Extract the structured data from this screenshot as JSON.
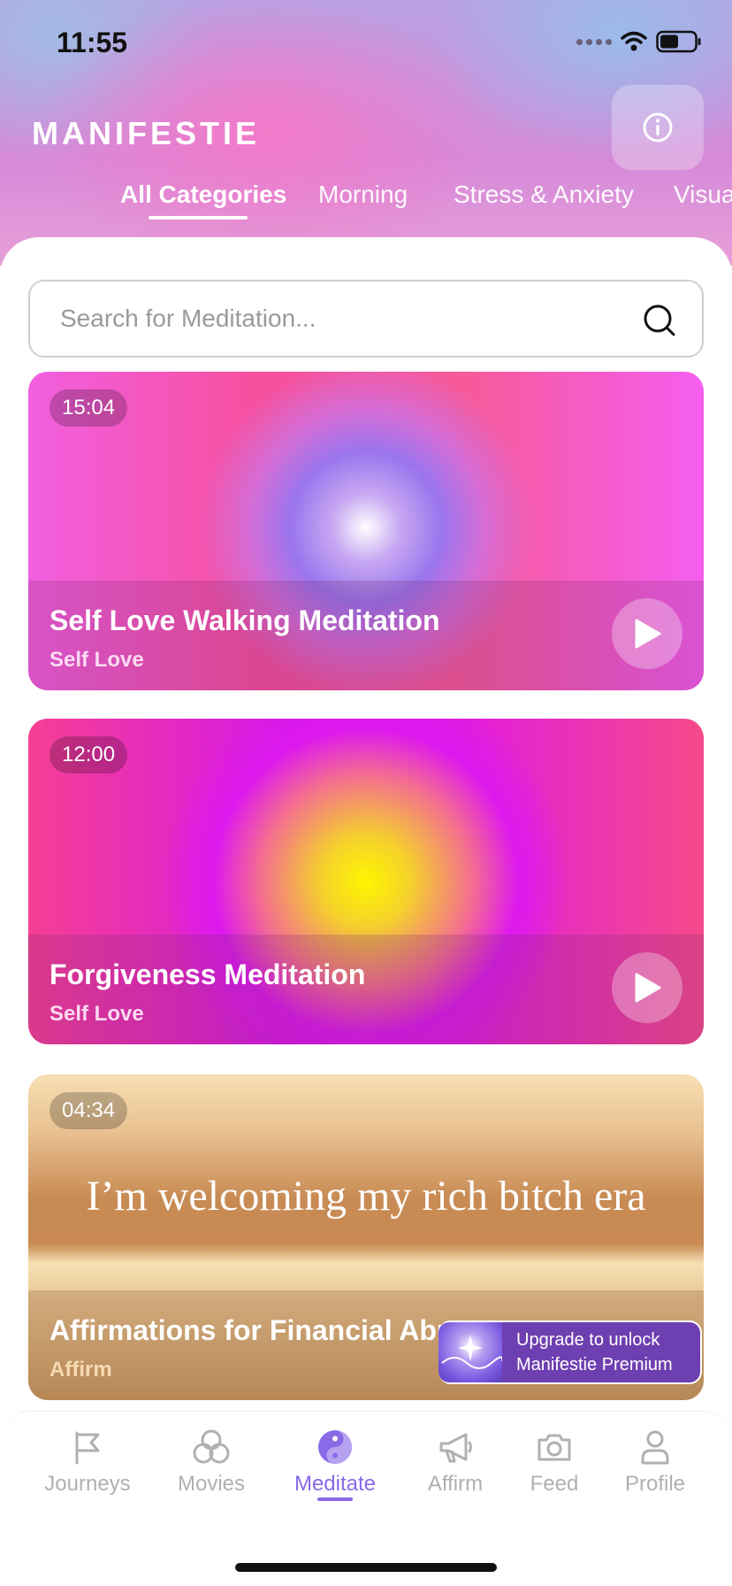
{
  "status_bar": {
    "time": "11:55"
  },
  "app": {
    "brand": "MANIFESTIE"
  },
  "categories": [
    {
      "label": "All Categories",
      "active": true
    },
    {
      "label": "Morning",
      "active": false
    },
    {
      "label": "Stress & Anxiety",
      "active": false
    },
    {
      "label": "Visua",
      "active": false
    }
  ],
  "search": {
    "placeholder": "Search for Meditation..."
  },
  "cards": [
    {
      "duration": "15:04",
      "title": "Self Love Walking Meditation",
      "subtitle": "Self Love"
    },
    {
      "duration": "12:00",
      "title": "Forgiveness Meditation",
      "subtitle": "Self Love"
    },
    {
      "duration": "04:34",
      "title": "Affirmations for Financial Abu",
      "subtitle": "Affirm",
      "overlay_text": "I’m welcoming my rich bitch era"
    }
  ],
  "upgrade": {
    "line1": "Upgrade to unlock",
    "line2": "Manifestie Premium"
  },
  "tabs": [
    {
      "label": "Journeys",
      "icon": "flag-icon"
    },
    {
      "label": "Movies",
      "icon": "circles-icon"
    },
    {
      "label": "Meditate",
      "icon": "yin-yang-icon",
      "active": true
    },
    {
      "label": "Affirm",
      "icon": "megaphone-icon"
    },
    {
      "label": "Feed",
      "icon": "camera-icon"
    },
    {
      "label": "Profile",
      "icon": "user-icon"
    }
  ],
  "colors": {
    "accent": "#8a6ae6",
    "upgrade_bg": "#6e3fb0"
  }
}
